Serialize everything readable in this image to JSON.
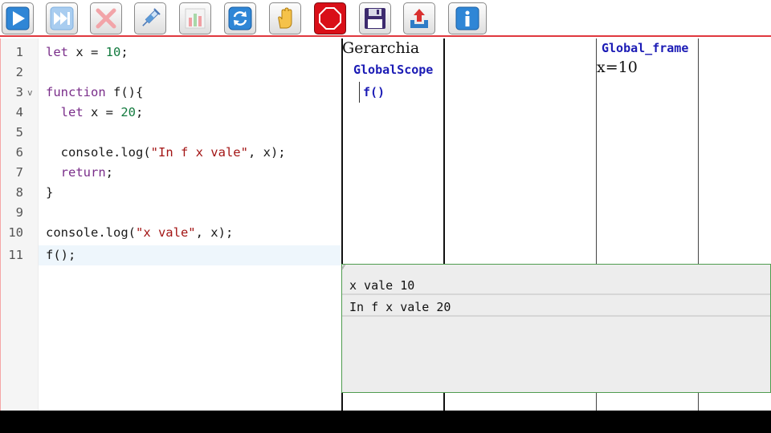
{
  "toolbar": {
    "buttons": [
      {
        "name": "run-button",
        "icon": "play-icon"
      },
      {
        "name": "fast-forward-button",
        "icon": "fast-forward-icon"
      },
      {
        "name": "stop-debug-button",
        "icon": "close-icon"
      },
      {
        "name": "inject-button",
        "icon": "syringe-icon"
      },
      {
        "name": "chart-button",
        "icon": "bar-chart-icon"
      },
      {
        "name": "refresh-button",
        "icon": "refresh-icon"
      },
      {
        "name": "hand-button",
        "icon": "hand-icon"
      },
      {
        "name": "stop-button",
        "icon": "stop-sign-icon"
      },
      {
        "name": "save-button",
        "icon": "floppy-disk-icon"
      },
      {
        "name": "upload-button",
        "icon": "upload-icon"
      },
      {
        "name": "info-button",
        "icon": "info-icon"
      }
    ]
  },
  "editor": {
    "lines": [
      {
        "n": "1",
        "code": "let x = 10;"
      },
      {
        "n": "2",
        "code": ""
      },
      {
        "n": "3",
        "code": "function f(){",
        "fold": "v"
      },
      {
        "n": "4",
        "code": "  let x = 20;"
      },
      {
        "n": "5",
        "code": ""
      },
      {
        "n": "6",
        "code": "  console.log(\"In f x vale\", x);"
      },
      {
        "n": "7",
        "code": "  return;"
      },
      {
        "n": "8",
        "code": "}"
      },
      {
        "n": "9",
        "code": ""
      },
      {
        "n": "10",
        "code": "console.log(\"x vale\", x);"
      },
      {
        "n": "11",
        "code": "f();"
      }
    ],
    "active_line": 11
  },
  "hierarchy": {
    "title": "Gerarchia",
    "root": "GlobalScope",
    "child": "f()"
  },
  "frame": {
    "title": "Global_frame",
    "variables": "x=10"
  },
  "console": {
    "lines": [
      "x vale 10",
      "In f x vale 20"
    ]
  },
  "colors": {
    "accent_red": "#e0383e",
    "scope_blue": "#1b1bb5",
    "console_border": "#4f9c4f"
  }
}
